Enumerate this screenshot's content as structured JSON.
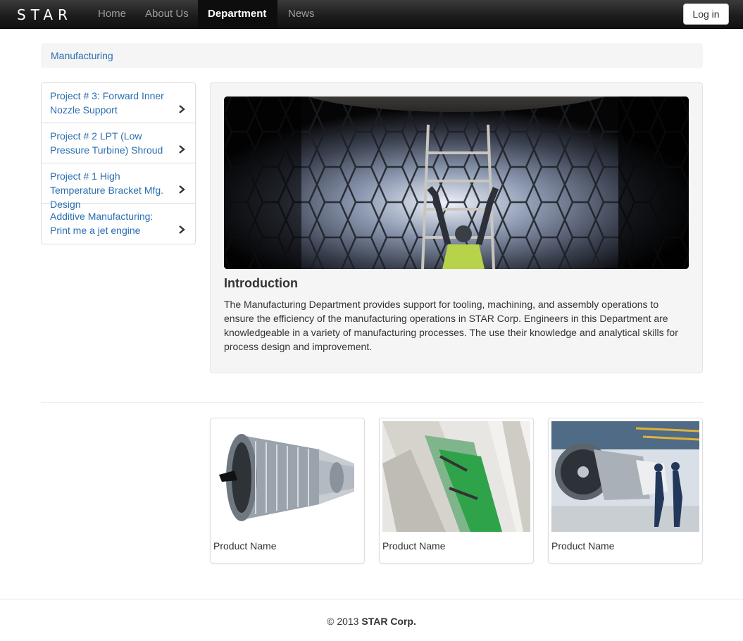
{
  "navbar": {
    "brand": "STAR",
    "items": [
      {
        "label": "Home"
      },
      {
        "label": "About Us"
      },
      {
        "label": "Department"
      },
      {
        "label": "News"
      }
    ],
    "login_label": "Log in"
  },
  "breadcrumb": {
    "current": "Manufacturing"
  },
  "sidebar": {
    "items": [
      {
        "label": "Project # 3: Forward Inner Nozzle Support"
      },
      {
        "label": "Project # 2 LPT (Low Pressure Turbine) Shroud"
      },
      {
        "label": "Project # 1 High Temperature Bracket Mfg. Design"
      },
      {
        "label": "Additive Manufacturing: Print me a jet engine"
      }
    ]
  },
  "main": {
    "intro_title": "Introduction",
    "intro_text": "The Manufacturing Department provides support for tooling, machining, and assembly operations to ensure the efficiency of the manufacturing operations in STAR Corp. Engineers in this Department are knowledgeable in a variety of manufacturing processes. The use their knowledge and analytical skills for process design and improvement."
  },
  "products": [
    {
      "name": "Product Name"
    },
    {
      "name": "Product Name"
    },
    {
      "name": "Product Name"
    }
  ],
  "footer": {
    "copyright": "© 2013",
    "company": "STAR Corp."
  },
  "colors": {
    "link": "#2a6db0",
    "navbar_bg": "#1b1b1b",
    "well_bg": "#f5f5f5"
  }
}
